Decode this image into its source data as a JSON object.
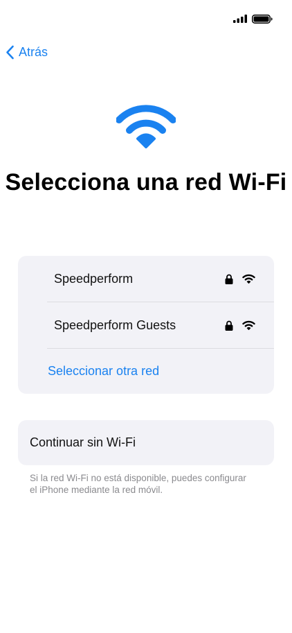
{
  "status_bar": {
    "signal_icon": "cellular-signal-icon",
    "battery_icon": "battery-full-icon"
  },
  "nav": {
    "back_label": "Atrás",
    "back_icon": "chevron-left-icon"
  },
  "hero": {
    "icon": "wifi-icon",
    "title": "Selecciona una red Wi-Fi"
  },
  "networks": [
    {
      "name": "Speedperform",
      "secured": true,
      "icon": "wifi-icon"
    },
    {
      "name": "Speedperform Guests",
      "secured": true,
      "icon": "wifi-icon"
    }
  ],
  "other_network_label": "Seleccionar otra red",
  "continue_without_wifi_label": "Continuar sin Wi-Fi",
  "footer_note": "Si la red Wi-Fi no está disponible, puedes configurar el iPhone mediante la red móvil.",
  "colors": {
    "accent": "#1a82f0",
    "card_background": "#f2f2f7",
    "secondary_text": "#8a8a8e"
  }
}
